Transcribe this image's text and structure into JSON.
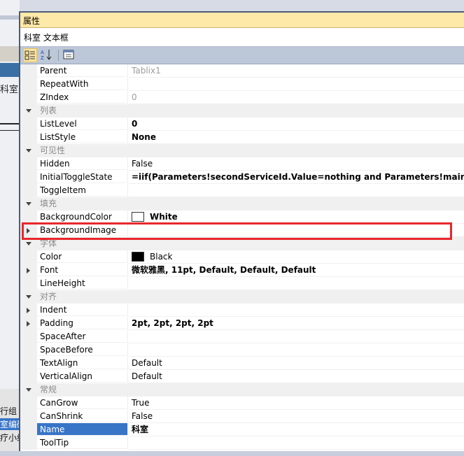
{
  "background": {
    "char_top": "科室",
    "left_items": [
      "行组",
      "室编码",
      "疗小组"
    ]
  },
  "window_title": "属性",
  "object_name": "科室 文本框",
  "toolbar": {
    "categorized_icon": "categorized-icon",
    "alphabetical_icon": "alphabetical-sort-icon",
    "property_pages_icon": "property-pages-icon"
  },
  "rows": [
    {
      "type": "prop",
      "name": "Parent",
      "value": "Tablix1",
      "style": "gray"
    },
    {
      "type": "prop",
      "name": "RepeatWith",
      "value": ""
    },
    {
      "type": "prop",
      "name": "ZIndex",
      "value": "0",
      "style": "gray"
    },
    {
      "type": "cat",
      "name": "列表"
    },
    {
      "type": "prop",
      "name": "ListLevel",
      "value": "0",
      "style": "bold"
    },
    {
      "type": "prop",
      "name": "ListStyle",
      "value": "None",
      "style": "bold"
    },
    {
      "type": "cat",
      "name": "可见性"
    },
    {
      "type": "prop",
      "name": "Hidden",
      "value": "False"
    },
    {
      "type": "prop",
      "name": "InitialToggleState",
      "value": "=iif(Parameters!secondServiceId.Value=nothing and Parameters!mainDiagnosis",
      "style": "bold"
    },
    {
      "type": "prop",
      "name": "ToggleItem",
      "value": ""
    },
    {
      "type": "cat",
      "name": "填充"
    },
    {
      "type": "prop",
      "name": "BackgroundColor",
      "value": "White",
      "style": "bold",
      "swatch": "#ffffff"
    },
    {
      "type": "prop",
      "name": "BackgroundImage",
      "value": "",
      "expander": true
    },
    {
      "type": "cat",
      "name": "字体"
    },
    {
      "type": "prop",
      "name": "Color",
      "value": "Black",
      "swatch": "#000000"
    },
    {
      "type": "prop",
      "name": "Font",
      "value": "微软雅黑, 11pt, Default, Default, Default",
      "style": "bold",
      "expander": true
    },
    {
      "type": "prop",
      "name": "LineHeight",
      "value": ""
    },
    {
      "type": "cat",
      "name": "对齐"
    },
    {
      "type": "prop",
      "name": "Indent",
      "value": "",
      "expander": true
    },
    {
      "type": "prop",
      "name": "Padding",
      "value": "2pt, 2pt, 2pt, 2pt",
      "style": "bold",
      "expander": true
    },
    {
      "type": "prop",
      "name": "SpaceAfter",
      "value": ""
    },
    {
      "type": "prop",
      "name": "SpaceBefore",
      "value": ""
    },
    {
      "type": "prop",
      "name": "TextAlign",
      "value": "Default"
    },
    {
      "type": "prop",
      "name": "VerticalAlign",
      "value": "Default"
    },
    {
      "type": "cat",
      "name": "常规"
    },
    {
      "type": "prop",
      "name": "CanGrow",
      "value": "True"
    },
    {
      "type": "prop",
      "name": "CanShrink",
      "value": "False"
    },
    {
      "type": "prop",
      "name": "Name",
      "value": "科室",
      "style": "bold",
      "selected": true
    },
    {
      "type": "prop",
      "name": "ToolTip",
      "value": ""
    }
  ]
}
